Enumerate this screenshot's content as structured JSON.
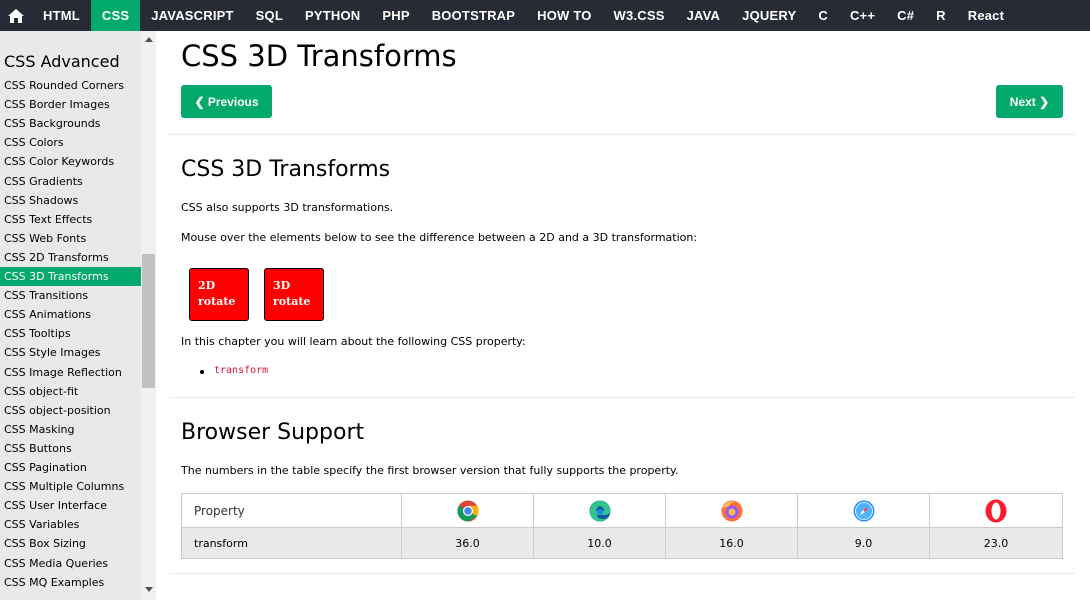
{
  "topnav": {
    "items": [
      {
        "label": "HTML",
        "active": false
      },
      {
        "label": "CSS",
        "active": true
      },
      {
        "label": "JAVASCRIPT",
        "active": false
      },
      {
        "label": "SQL",
        "active": false
      },
      {
        "label": "PYTHON",
        "active": false
      },
      {
        "label": "PHP",
        "active": false
      },
      {
        "label": "BOOTSTRAP",
        "active": false
      },
      {
        "label": "HOW TO",
        "active": false
      },
      {
        "label": "W3.CSS",
        "active": false
      },
      {
        "label": "JAVA",
        "active": false
      },
      {
        "label": "JQUERY",
        "active": false
      },
      {
        "label": "C",
        "active": false
      },
      {
        "label": "C++",
        "active": false
      },
      {
        "label": "C#",
        "active": false
      },
      {
        "label": "R",
        "active": false
      },
      {
        "label": "React",
        "active": false
      }
    ]
  },
  "sidebar": {
    "heading": "CSS Advanced",
    "items": [
      "CSS Rounded Corners",
      "CSS Border Images",
      "CSS Backgrounds",
      "CSS Colors",
      "CSS Color Keywords",
      "CSS Gradients",
      "CSS Shadows",
      "CSS Text Effects",
      "CSS Web Fonts",
      "CSS 2D Transforms",
      "CSS 3D Transforms",
      "CSS Transitions",
      "CSS Animations",
      "CSS Tooltips",
      "CSS Style Images",
      "CSS Image Reflection",
      "CSS object-fit",
      "CSS object-position",
      "CSS Masking",
      "CSS Buttons",
      "CSS Pagination",
      "CSS Multiple Columns",
      "CSS User Interface",
      "CSS Variables",
      "CSS Box Sizing",
      "CSS Media Queries",
      "CSS MQ Examples"
    ],
    "active_index": 10
  },
  "main": {
    "title": "CSS 3D Transforms",
    "prev_label": "❮ Previous",
    "next_label": "Next ❯",
    "section1": {
      "heading": "CSS 3D Transforms",
      "p1": "CSS also supports 3D transformations.",
      "p2": "Mouse over the elements below to see the difference between a 2D and a 3D transformation:",
      "box2d_line1": "2D",
      "box2d_line2": "rotate",
      "box3d_line1": "3D",
      "box3d_line2": "rotate",
      "p3": "In this chapter you will learn about the following CSS property:",
      "property": "transform"
    },
    "section2": {
      "heading": "Browser Support",
      "p1": "The numbers in the table specify the first browser version that fully supports the property.",
      "table": {
        "header_first": "Property",
        "browsers": [
          "chrome-icon",
          "edge-icon",
          "firefox-icon",
          "safari-icon",
          "opera-icon"
        ],
        "row_property": "transform",
        "row_values": [
          "36.0",
          "10.0",
          "16.0",
          "9.0",
          "23.0"
        ]
      }
    }
  },
  "colors": {
    "accent": "#04AA6D",
    "topnav_bg": "#282A35",
    "sidebar_bg": "#E7E9EB",
    "box_red": "#FF0000",
    "code_red": "#DC143C"
  }
}
